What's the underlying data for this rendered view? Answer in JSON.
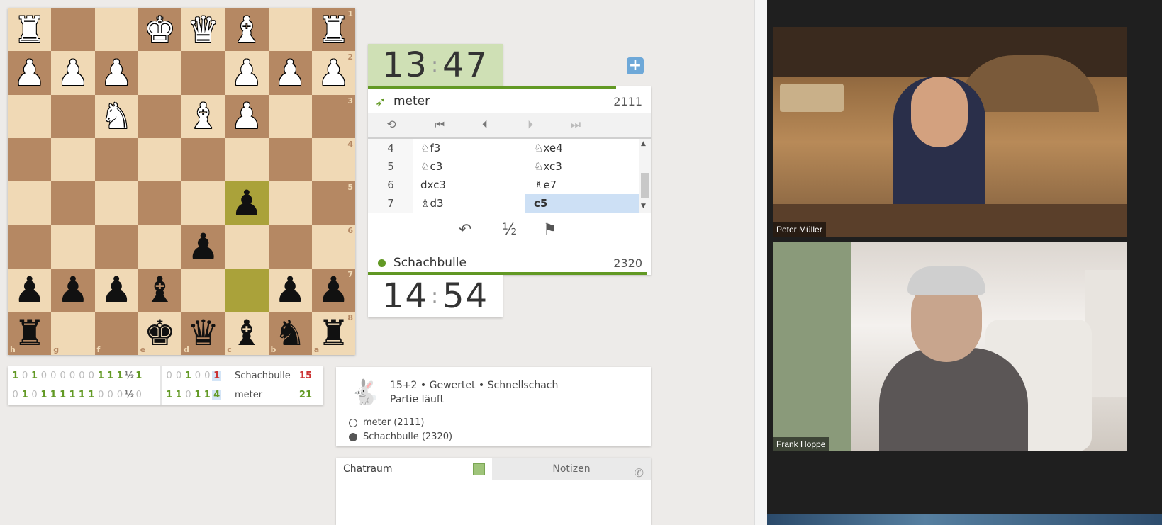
{
  "board": {
    "ranks": [
      "1",
      "2",
      "3",
      "4",
      "5",
      "6",
      "7",
      "8"
    ],
    "files": [
      "h",
      "g",
      "f",
      "e",
      "d",
      "c",
      "b",
      "a"
    ],
    "rows": [
      [
        "wR",
        "",
        "",
        "wK",
        "wQ",
        "wB",
        "",
        "wR"
      ],
      [
        "wP",
        "wP",
        "wP",
        "",
        "",
        "wP",
        "wP",
        "wP"
      ],
      [
        "",
        "",
        "wN",
        "",
        "wB",
        "wP",
        "",
        ""
      ],
      [
        "",
        "",
        "",
        "",
        "",
        "",
        "",
        ""
      ],
      [
        "",
        "",
        "",
        "",
        "",
        "bP",
        "",
        ""
      ],
      [
        "",
        "",
        "",
        "",
        "bP",
        "",
        "",
        ""
      ],
      [
        "bP",
        "bP",
        "bP",
        "bB",
        "",
        "",
        "bP",
        "bP"
      ],
      [
        "bR",
        "",
        "",
        "bK",
        "bQ",
        "bB",
        "bN",
        "bR"
      ]
    ],
    "highlight": [
      [
        4,
        5
      ],
      [
        6,
        5
      ]
    ]
  },
  "crosstable": {
    "rows": [
      {
        "results": [
          "1",
          "0",
          "1",
          "0",
          "0",
          "0",
          "0",
          "0",
          "0",
          "1",
          "1",
          "1",
          "½",
          "1"
        ],
        "recent": [
          "0",
          "0",
          "1",
          "0",
          "0",
          "1"
        ],
        "name": "Schachbulle",
        "score": "15"
      },
      {
        "results": [
          "0",
          "1",
          "0",
          "1",
          "1",
          "1",
          "1",
          "1",
          "1",
          "0",
          "0",
          "0",
          "½",
          "0"
        ],
        "recent": [
          "1",
          "1",
          "0",
          "1",
          "1",
          "4"
        ],
        "name": "meter",
        "score": "21"
      }
    ]
  },
  "clocks": {
    "top": {
      "min": "13",
      "sec": "47"
    },
    "bottom": {
      "min": "14",
      "sec": "54"
    }
  },
  "players": {
    "top": {
      "name": "meter",
      "rating": "2111"
    },
    "bottom": {
      "name": "Schachbulle",
      "rating": "2320"
    }
  },
  "moves": [
    {
      "num": "4",
      "white": "♘f3",
      "black": "♘xe4"
    },
    {
      "num": "5",
      "white": "♘c3",
      "black": "♘xc3"
    },
    {
      "num": "6",
      "white": "dxc3",
      "black": "♗e7"
    },
    {
      "num": "7",
      "white": "♗d3",
      "black": "c5"
    }
  ],
  "actions": {
    "takeback": "↶",
    "draw": "½",
    "resign": "⚑"
  },
  "game_info": {
    "line1": "15+2 • Gewertet • Schnellschach",
    "line2": "Partie läuft",
    "white": "meter (2111)",
    "black": "Schachbulle (2320)"
  },
  "chat": {
    "tab": "Chatraum",
    "notes": "Notizen"
  },
  "video": {
    "top_name": "Peter Müller",
    "bottom_name": "Frank Hoppe"
  },
  "colors": {
    "accent_green": "#629924",
    "light_square": "#f0d9b5",
    "dark_square": "#b58863",
    "highlight": "#aaa23a",
    "active_move": "#cde0f5"
  }
}
